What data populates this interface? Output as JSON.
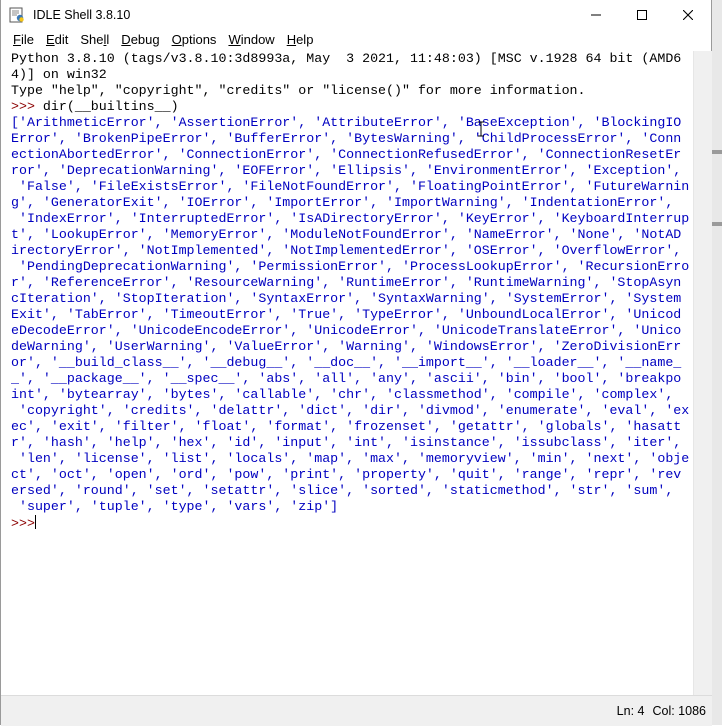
{
  "window": {
    "title": "IDLE Shell 3.8.10",
    "controls": {
      "minimize": "—",
      "maximize": "☐",
      "close": "✕"
    }
  },
  "menu": [
    {
      "key": "F",
      "rest": "ile"
    },
    {
      "key": "E",
      "rest": "dit"
    },
    {
      "pre": "She",
      "key": "l",
      "rest": "l"
    },
    {
      "key": "D",
      "rest": "ebug"
    },
    {
      "key": "O",
      "rest": "ptions"
    },
    {
      "key": "W",
      "rest": "indow"
    },
    {
      "key": "H",
      "rest": "elp"
    }
  ],
  "shell": {
    "banner": [
      "Python 3.8.10 (tags/v3.8.10:3d8993a, May  3 2021, 11:48:03) [MSC v.1928 64 bit (AMD6",
      "4)] on win32",
      "Type \"help\", \"copyright\", \"credits\" or \"license()\" for more information."
    ],
    "prompt": ">>> ",
    "command": "dir(__builtins__)",
    "output": [
      "['ArithmeticError', 'AssertionError', 'AttributeError', 'BaseException', 'BlockingIO",
      "Error', 'BrokenPipeError', 'BufferError', 'BytesWarning', 'ChildProcessError', 'Conn",
      "ectionAbortedError', 'ConnectionError', 'ConnectionRefusedError', 'ConnectionResetEr",
      "ror', 'DeprecationWarning', 'EOFError', 'Ellipsis', 'EnvironmentError', 'Exception',",
      " 'False', 'FileExistsError', 'FileNotFoundError', 'FloatingPointError', 'FutureWarnin",
      "g', 'GeneratorExit', 'IOError', 'ImportError', 'ImportWarning', 'IndentationError',",
      " 'IndexError', 'InterruptedError', 'IsADirectoryError', 'KeyError', 'KeyboardInterrup",
      "t', 'LookupError', 'MemoryError', 'ModuleNotFoundError', 'NameError', 'None', 'NotAD",
      "irectoryError', 'NotImplemented', 'NotImplementedError', 'OSError', 'OverflowError',",
      " 'PendingDeprecationWarning', 'PermissionError', 'ProcessLookupError', 'RecursionErro",
      "r', 'ReferenceError', 'ResourceWarning', 'RuntimeError', 'RuntimeWarning', 'StopAsyn",
      "cIteration', 'StopIteration', 'SyntaxError', 'SyntaxWarning', 'SystemError', 'System",
      "Exit', 'TabError', 'TimeoutError', 'True', 'TypeError', 'UnboundLocalError', 'Unicod",
      "eDecodeError', 'UnicodeEncodeError', 'UnicodeError', 'UnicodeTranslateError', 'Unico",
      "deWarning', 'UserWarning', 'ValueError', 'Warning', 'WindowsError', 'ZeroDivisionErr",
      "or', '__build_class__', '__debug__', '__doc__', '__import__', '__loader__', '__name_",
      "_', '__package__', '__spec__', 'abs', 'all', 'any', 'ascii', 'bin', 'bool', 'breakpo",
      "int', 'bytearray', 'bytes', 'callable', 'chr', 'classmethod', 'compile', 'complex',",
      " 'copyright', 'credits', 'delattr', 'dict', 'dir', 'divmod', 'enumerate', 'eval', 'ex",
      "ec', 'exit', 'filter', 'float', 'format', 'frozenset', 'getattr', 'globals', 'hasatt",
      "r', 'hash', 'help', 'hex', 'id', 'input', 'int', 'isinstance', 'issubclass', 'iter',",
      " 'len', 'license', 'list', 'locals', 'map', 'max', 'memoryview', 'min', 'next', 'obje",
      "ct', 'oct', 'open', 'ord', 'pow', 'print', 'property', 'quit', 'range', 'repr', 'rev",
      "ersed', 'round', 'set', 'setattr', 'slice', 'sorted', 'staticmethod', 'str', 'sum',",
      " 'super', 'tuple', 'type', 'vars', 'zip']"
    ],
    "final_prompt": ">>>"
  },
  "status": {
    "line": "Ln: 4",
    "col": "Col: 1086"
  },
  "colors": {
    "prompt": "#8b0000",
    "output": "#0000c0",
    "text": "#000000"
  }
}
